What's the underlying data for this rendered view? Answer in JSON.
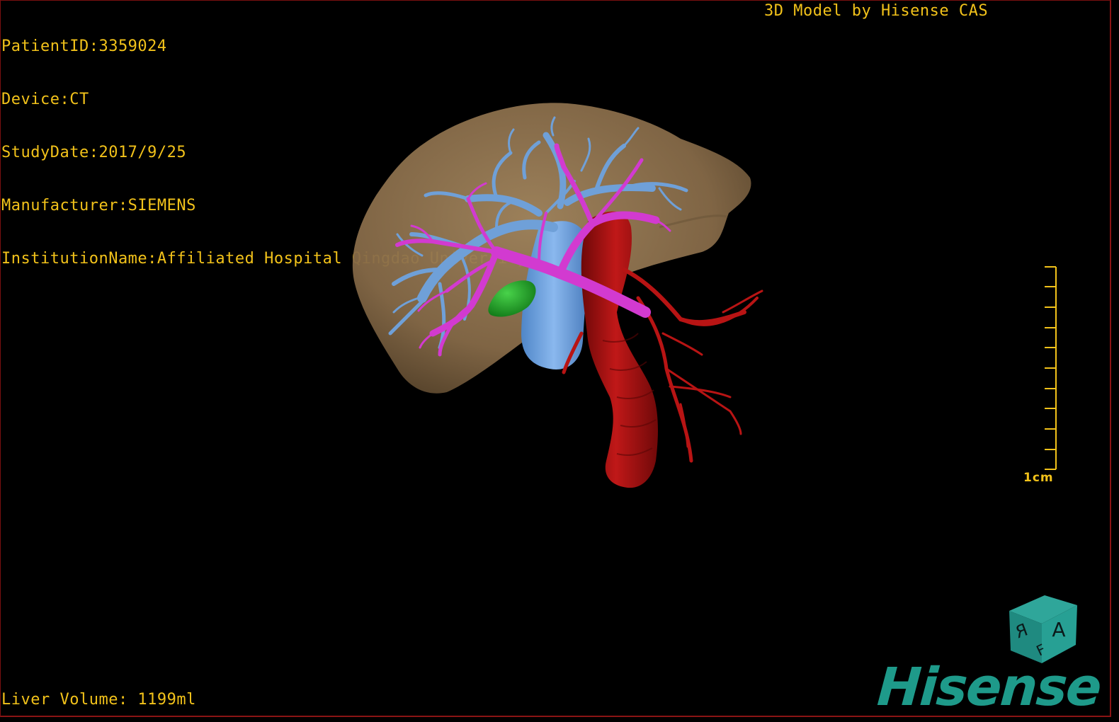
{
  "study": {
    "patient_id": "PatientID:3359024",
    "device": "Device:CT",
    "study_date": "StudyDate:2017/9/25",
    "manufacturer": "Manufacturer:SIEMENS",
    "institution": "InstitutionName:Affiliated Hospital Qingdao University-C"
  },
  "credit": "3D Model by Hisense CAS",
  "liver_volume": "Liver Volume: 1199ml",
  "scale_bar": {
    "label": "1cm"
  },
  "orientation_cube": {
    "face_front": "A",
    "face_left": "R",
    "face_bottom": "F"
  },
  "brand": "Hisense",
  "colors": {
    "overlay_text": "#f2c21a",
    "liver": "#8c7250",
    "portal_vein": "#6fa0d8",
    "hepatic_artery_branch": "#d23ad0",
    "aorta": "#a01212",
    "gallbladder": "#1fa12a",
    "brand": "#1e9a8a"
  }
}
